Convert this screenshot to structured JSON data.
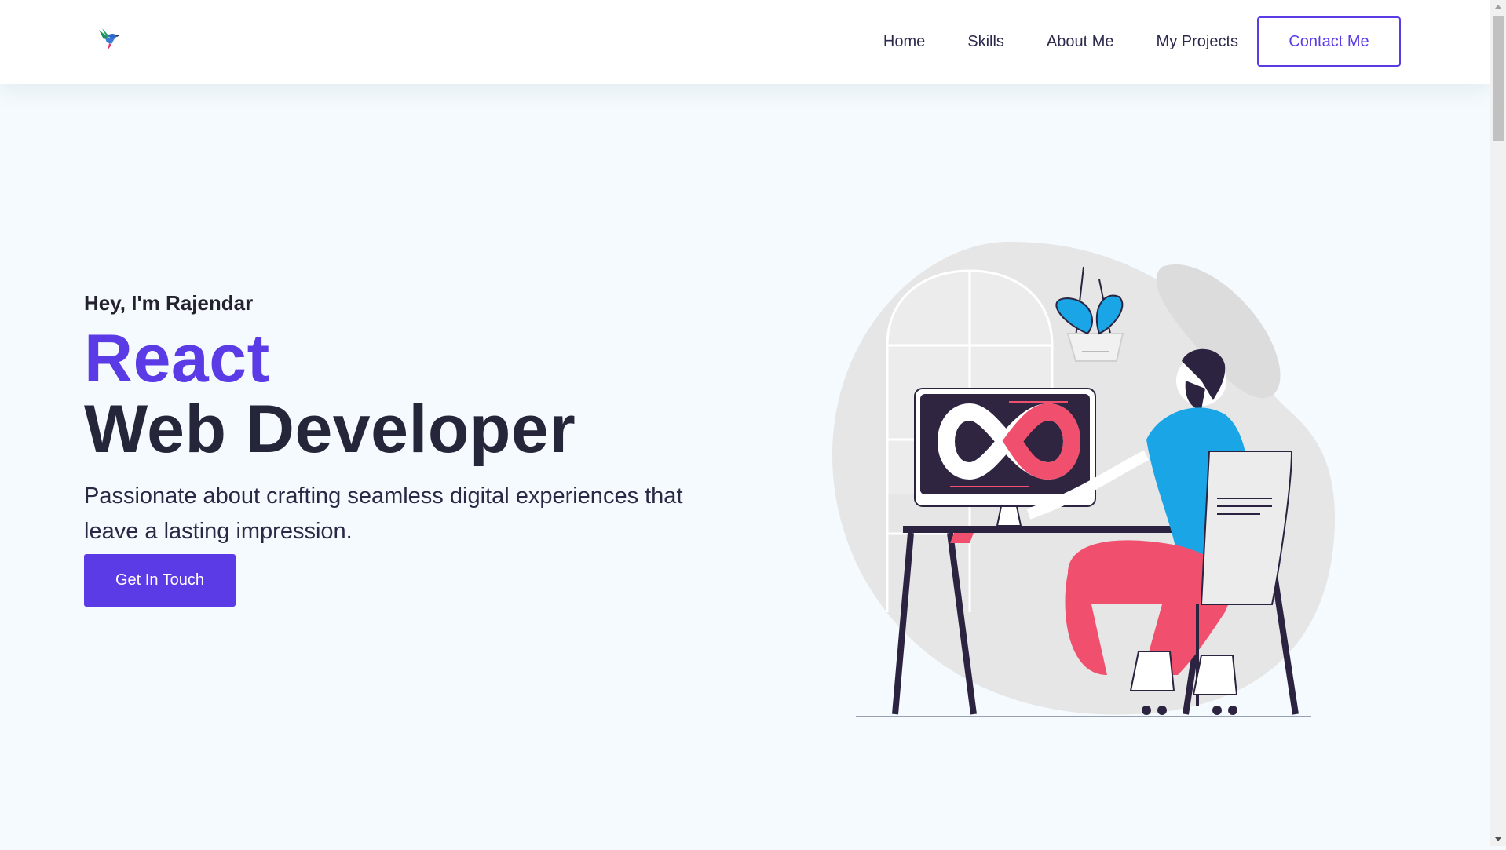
{
  "header": {
    "logo_icon": "hummingbird-icon",
    "nav": {
      "home": "Home",
      "skills": "Skills",
      "about": "About Me",
      "projects": "My Projects"
    },
    "contact_label": "Contact Me"
  },
  "hero": {
    "greeting": "Hey, I'm Rajendar",
    "title_accent": "React",
    "title_main": "Web Developer",
    "description": "Passionate about crafting seamless digital experiences that leave a lasting impression.",
    "cta_label": "Get In Touch",
    "illustration": "developer-at-desk-illustration"
  },
  "colors": {
    "accent": "#5b3be6",
    "background": "#f4fafd",
    "text": "#26263a"
  }
}
